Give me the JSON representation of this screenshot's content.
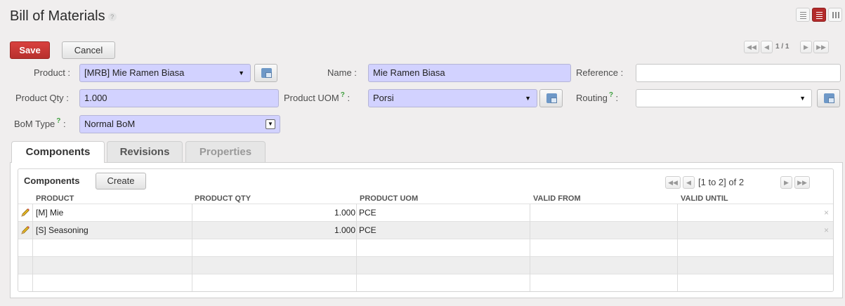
{
  "header": {
    "title": "Bill of Materials",
    "help_glyph": "?"
  },
  "toolbar": {
    "save_label": "Save",
    "cancel_label": "Cancel"
  },
  "record_pager": {
    "first": "◀◀",
    "prev": "◀",
    "value": "1 / 1",
    "next": "▶",
    "last": "▶▶"
  },
  "form": {
    "product": {
      "label": "Product :",
      "value": "[MRB] Mie Ramen Biasa"
    },
    "name": {
      "label": "Name :",
      "value": "Mie Ramen Biasa"
    },
    "reference": {
      "label": "Reference :",
      "value": ""
    },
    "product_qty": {
      "label": "Product Qty :",
      "value": "1.000"
    },
    "product_uom": {
      "label": "Product UOM",
      "help": "?",
      "colon": ":",
      "value": "Porsi"
    },
    "routing": {
      "label": "Routing",
      "help": "?",
      "colon": ":",
      "value": ""
    },
    "bom_type": {
      "label": "BoM Type",
      "help": "?",
      "colon": ":",
      "value": "Normal BoM"
    },
    "dropdown_glyph": "▼"
  },
  "tabs": [
    {
      "label": "Components",
      "state": "active"
    },
    {
      "label": "Revisions",
      "state": "inactive"
    },
    {
      "label": "Properties",
      "state": "disabled"
    }
  ],
  "components": {
    "title": "Components",
    "create_label": "Create",
    "pager": {
      "first": "◀◀",
      "prev": "◀",
      "text": "[1 to 2] of 2",
      "next": "▶",
      "last": "▶▶"
    },
    "columns": [
      "PRODUCT",
      "PRODUCT QTY",
      "PRODUCT UOM",
      "VALID FROM",
      "VALID UNTIL"
    ],
    "rows": [
      {
        "product": "[M] Mie",
        "qty": "1.000",
        "uom": "PCE",
        "valid_from": "",
        "valid_until": "",
        "delete": "×"
      },
      {
        "product": "[S] Seasoning",
        "qty": "1.000",
        "uom": "PCE",
        "valid_from": "",
        "valid_until": "",
        "delete": "×"
      }
    ]
  },
  "colors": {
    "accent_red": "#b32b2b",
    "required_field": "#d2d2ff",
    "help_green": "#3f9f3f"
  }
}
